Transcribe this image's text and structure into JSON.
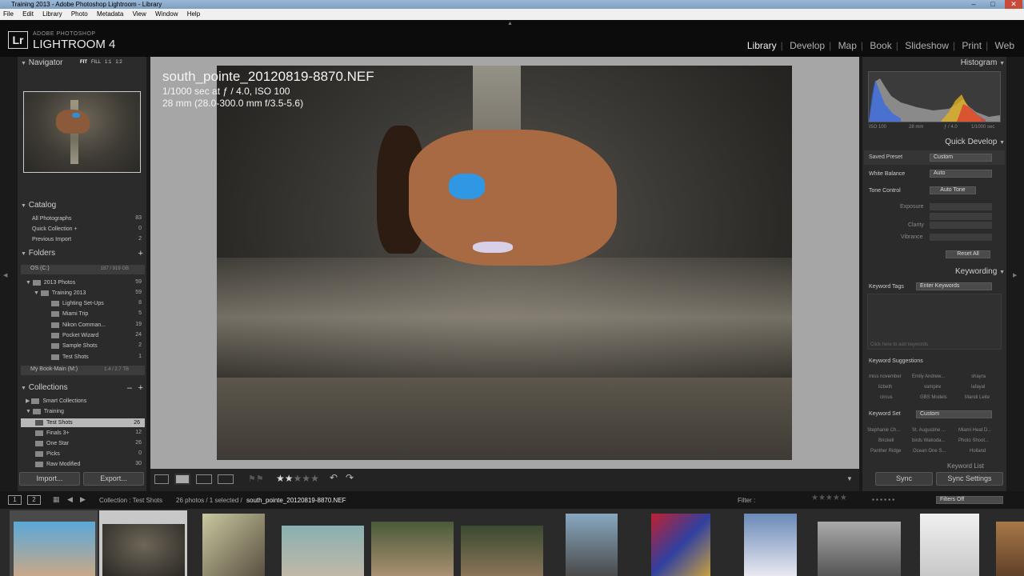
{
  "window": {
    "title": "Training 2013 - Adobe Photoshop Lightroom - Library"
  },
  "menu": [
    "File",
    "Edit",
    "Library",
    "Photo",
    "Metadata",
    "View",
    "Window",
    "Help"
  ],
  "brand": {
    "top": "ADOBE PHOTOSHOP",
    "name": "LIGHTROOM 4",
    "logo": "Lr"
  },
  "modules": [
    "Library",
    "Develop",
    "Map",
    "Book",
    "Slideshow",
    "Print",
    "Web"
  ],
  "navigator": {
    "title": "Navigator",
    "zoom": [
      "FIT",
      "FILL",
      "1:1",
      "1:2"
    ]
  },
  "catalog": {
    "title": "Catalog",
    "items": [
      {
        "label": "All Photographs",
        "count": "83"
      },
      {
        "label": "Quick Collection +",
        "count": "0"
      },
      {
        "label": "Previous Import",
        "count": "2"
      }
    ]
  },
  "folders": {
    "title": "Folders",
    "drive": "OS (C:)",
    "drive_info": "187 / 919 GB",
    "items": [
      {
        "label": "2013 Photos",
        "count": "59"
      },
      {
        "label": "Training 2013",
        "count": "59"
      },
      {
        "label": "Lighting Set-Ups",
        "count": "8"
      },
      {
        "label": "Miami Trip",
        "count": "5"
      },
      {
        "label": "Nikon Comman...",
        "count": "19"
      },
      {
        "label": "Pocket Wizard",
        "count": "24"
      },
      {
        "label": "Sample Shots",
        "count": "2"
      },
      {
        "label": "Test Shots",
        "count": "1"
      }
    ],
    "book": "My Book-Main (M:)",
    "book_info": "1.4 / 2.7 TB"
  },
  "collections": {
    "title": "Collections",
    "items": [
      {
        "label": "Smart Collections",
        "count": ""
      },
      {
        "label": "Training",
        "count": ""
      },
      {
        "label": "Test Shots",
        "count": "26"
      },
      {
        "label": "Finals 3+",
        "count": "12"
      },
      {
        "label": "One Star",
        "count": "26"
      },
      {
        "label": "Picks",
        "count": "0"
      },
      {
        "label": "Raw Modified",
        "count": "30"
      }
    ]
  },
  "left_buttons": {
    "import": "Import...",
    "export": "Export..."
  },
  "photo": {
    "filename": "south_pointe_20120819-8870.NEF",
    "exposure": "1/1000 sec at ƒ / 4.0, ISO 100",
    "lens": "28 mm (28.0-300.0 mm f/3.5-5.6)"
  },
  "histogram": {
    "title": "Histogram",
    "info": [
      "ISO 100",
      "28 mm",
      "ƒ / 4.0",
      "1/1000 sec"
    ]
  },
  "quick_develop": {
    "title": "Quick Develop",
    "saved_preset": {
      "label": "Saved Preset",
      "value": "Custom"
    },
    "white_balance": {
      "label": "White Balance",
      "value": "Auto"
    },
    "tone_control": {
      "label": "Tone Control",
      "button": "Auto Tone"
    },
    "rows": [
      "Exposure",
      "Clarity",
      "Vibrance"
    ],
    "reset": "Reset All"
  },
  "keywording": {
    "title": "Keywording",
    "tags_label": "Keyword Tags",
    "tags_value": "Enter Keywords",
    "placeholder": "Click here to add keywords",
    "suggestions_label": "Keyword Suggestions",
    "suggestions": [
      "miss november",
      "Emily Andrew...",
      "shayra",
      "lizbeth",
      "vampire",
      "lafayal",
      "circus",
      "GBS Models",
      "Mandi Leite"
    ],
    "set_label": "Keyword Set",
    "set_value": "Custom",
    "set_items": [
      "Stephanie Ch...",
      "St. Augustine ...",
      "Miami Heat D...",
      "Brickell",
      "birds Wakoda...",
      "Photo Shoot...",
      "Panther Ridge",
      "Ocean One S...",
      "Holland"
    ],
    "list_label": "Keyword List"
  },
  "sync": {
    "sync": "Sync",
    "settings": "Sync Settings"
  },
  "filmstrip_bar": {
    "pages": [
      "1",
      "2"
    ],
    "source_prefix": "Collection : Test Shots",
    "count_text": "26 photos / 1 selected /",
    "selected_file": "south_pointe_20120819-8870.NEF",
    "filter_label": "Filter :",
    "filter_value": "Filters Off"
  },
  "rating_stars": 2,
  "colors": {
    "accent": "#e8e8e8",
    "panel": "#2b2b2b",
    "center": "#a6a6a6"
  }
}
